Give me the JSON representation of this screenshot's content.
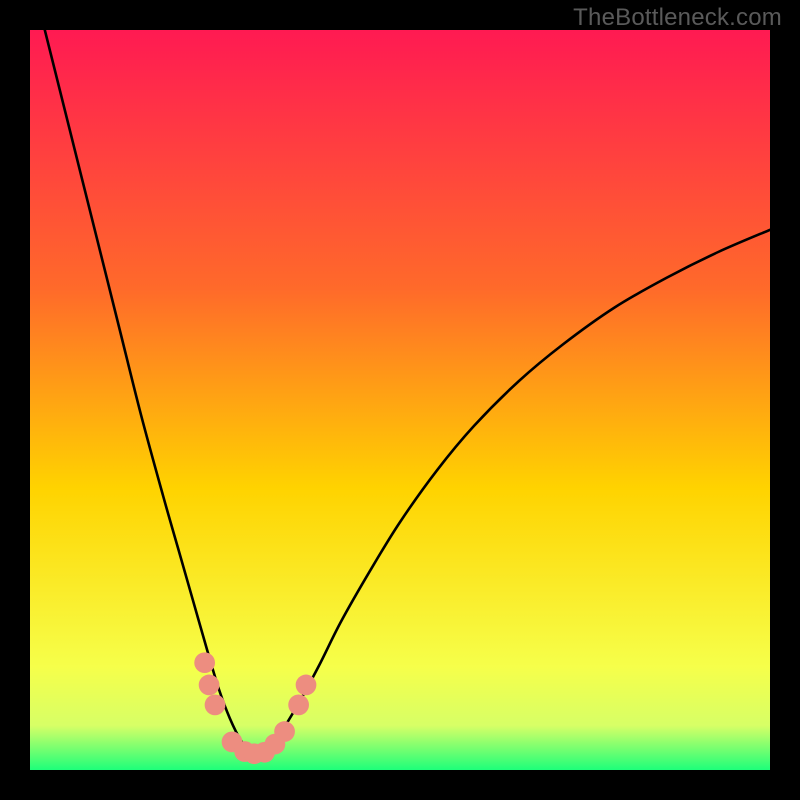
{
  "watermark": "TheBottleneck.com",
  "colors": {
    "frame": "#000000",
    "grad_top": "#ff1a52",
    "grad_mid1": "#ff6a2a",
    "grad_mid2": "#ffd300",
    "grad_low1": "#f6ff4a",
    "grad_low2": "#d7ff66",
    "grad_bottom": "#1eff7a",
    "curve": "#000000",
    "marker_fill": "#ed8d80",
    "marker_stroke": "#ed8d80"
  },
  "chart_data": {
    "type": "line",
    "title": "",
    "xlabel": "",
    "ylabel": "",
    "xlim": [
      0,
      100
    ],
    "ylim": [
      0,
      100
    ],
    "curve": {
      "x": [
        0,
        3,
        6,
        9,
        12,
        15,
        18,
        20,
        22,
        24,
        25.5,
        27,
        28.5,
        30,
        31.5,
        33.5,
        36,
        39,
        42,
        46,
        50,
        55,
        60,
        66,
        72,
        79,
        86,
        93,
        100
      ],
      "y": [
        108,
        96,
        84,
        72,
        60,
        48,
        37,
        30,
        23,
        16,
        11,
        7,
        4,
        2.2,
        2.2,
        4.5,
        8.5,
        14,
        20,
        27,
        33.5,
        40.5,
        46.5,
        52.5,
        57.5,
        62.5,
        66.5,
        70,
        73
      ]
    },
    "markers": [
      {
        "x": 23.6,
        "y": 14.5
      },
      {
        "x": 24.2,
        "y": 11.5
      },
      {
        "x": 25.0,
        "y": 8.8
      },
      {
        "x": 27.3,
        "y": 3.8
      },
      {
        "x": 29.0,
        "y": 2.5
      },
      {
        "x": 30.3,
        "y": 2.2
      },
      {
        "x": 31.7,
        "y": 2.4
      },
      {
        "x": 33.1,
        "y": 3.5
      },
      {
        "x": 34.4,
        "y": 5.2
      },
      {
        "x": 36.3,
        "y": 8.8
      },
      {
        "x": 37.3,
        "y": 11.5
      }
    ],
    "marker_radius_units": 1.4
  }
}
